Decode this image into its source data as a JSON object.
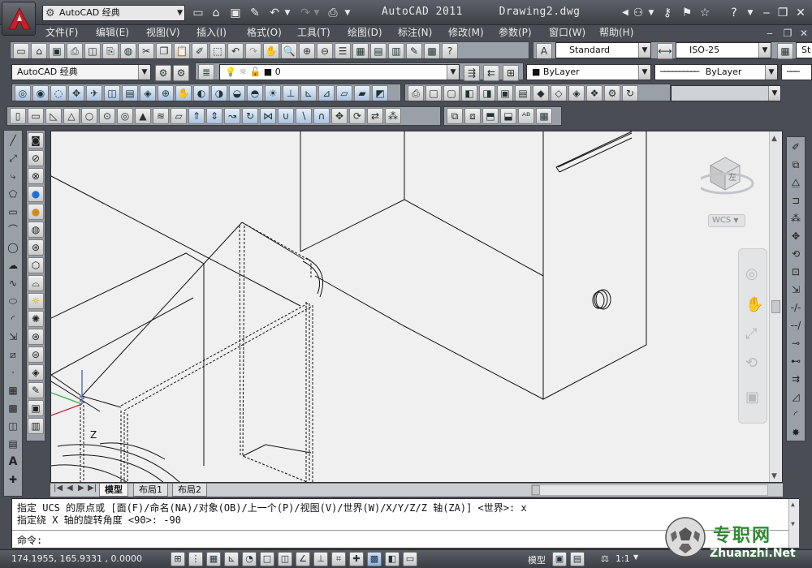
{
  "titlebar": {
    "workspace": "AutoCAD 经典",
    "app_title": "AutoCAD 2011",
    "doc_title": "Drawing2.dwg"
  },
  "menubar": {
    "items": [
      "文件(F)",
      "编辑(E)",
      "视图(V)",
      "插入(I)",
      "格式(O)",
      "工具(T)",
      "绘图(D)",
      "标注(N)",
      "修改(M)",
      "参数(P)",
      "窗口(W)",
      "帮助(H)"
    ]
  },
  "toolbars": {
    "text_style": "Standard",
    "dim_style": "ISO-25",
    "table_style_prefix": "St",
    "workspace_combo": "AutoCAD 经典",
    "layer_value": "0",
    "color_value": "ByLayer",
    "linetype_value": "ByLayer"
  },
  "viewcube": {
    "face_label": "左",
    "wcs_label": "WCS"
  },
  "layout_tabs": {
    "tabs": [
      "模型",
      "布局1",
      "布局2"
    ],
    "active": "模型"
  },
  "command": {
    "history_line_1": "指定 UCS 的原点或 [面(F)/命名(NA)/对象(OB)/上一个(P)/视图(V)/世界(W)/X/Y/Z/Z 轴(ZA)] <世界>: x",
    "history_line_2": "指定绕 X 轴的旋转角度 <90>: -90",
    "prompt": "命令:"
  },
  "statusbar": {
    "coords": "174.1955,  165.9331 , 0.0000",
    "model_label": "模型",
    "scale_label": "1:1"
  },
  "watermark": {
    "site_cn": "专职网",
    "site_en": "Zhuanzhi.Net"
  },
  "colors": {
    "ui_dark": "#4a4e54",
    "canvas_bg": "#f0f0f0",
    "app_red": "#c8202a",
    "axis_green": "#2fb24a",
    "axis_blue": "#2d56d8",
    "watermark_green": "#2f8a34"
  }
}
